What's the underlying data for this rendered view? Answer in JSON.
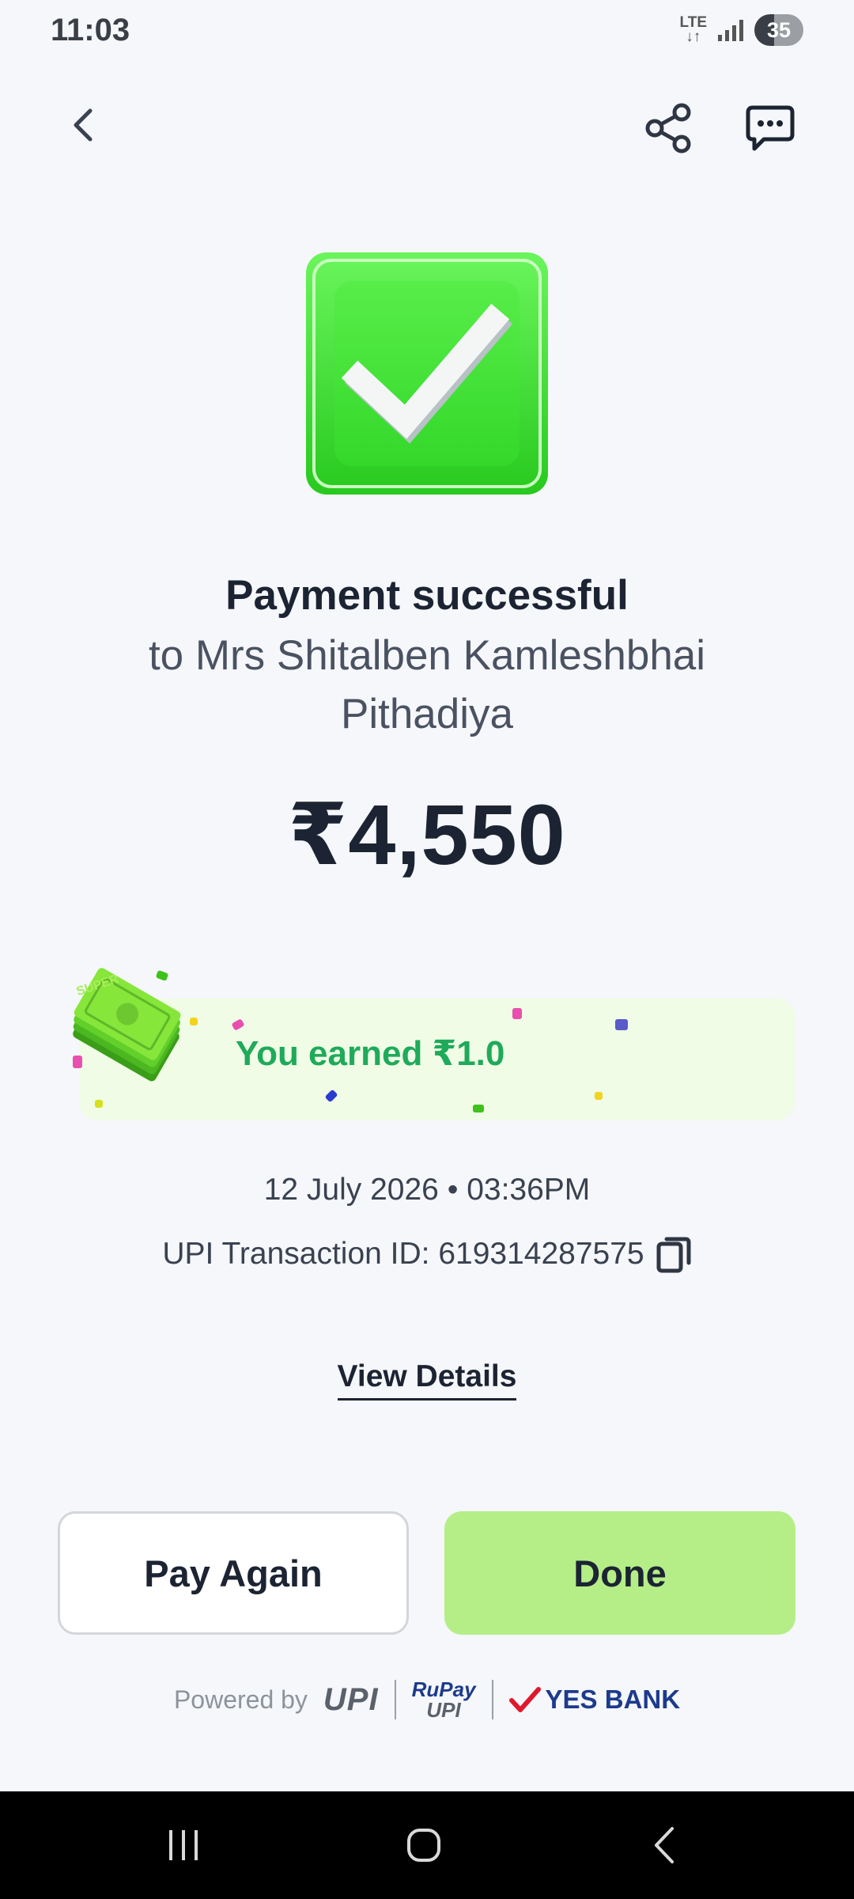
{
  "status_bar": {
    "time": "11:03",
    "network": "LTE",
    "battery": "35"
  },
  "top_bar": {
    "back_icon": "chevron-left-icon",
    "share_icon": "share-icon",
    "chat_icon": "chat-bubble-icon"
  },
  "payment": {
    "status_icon": "checkmark-badge-icon",
    "title": "Payment successful",
    "recipient": "to Mrs Shitalben Kamleshbhai Pithadiya",
    "amount": "₹4,550"
  },
  "reward": {
    "text": "You earned ₹1.0",
    "cash_label": "SUPER"
  },
  "transaction": {
    "datetime": "12 July 2026 • 03:36PM",
    "upi_id": "UPI Transaction ID: 619314287575",
    "copy_icon": "copy-icon"
  },
  "links": {
    "view_details": "View Details"
  },
  "actions": {
    "pay_again": "Pay Again",
    "done": "Done"
  },
  "footer": {
    "powered_by": "Powered by",
    "upi": "UPI",
    "rupay": "RuPay",
    "rupay_upi": "UPI",
    "bank": "YES BANK"
  },
  "nav": {
    "recents_icon": "recents-icon",
    "home_icon": "home-icon",
    "back_icon": "nav-back-icon"
  },
  "colors": {
    "background": "#f5f7fa",
    "success_green": "#3ee03a",
    "reward_text": "#1faa5a",
    "done_button": "#b5ee87"
  }
}
